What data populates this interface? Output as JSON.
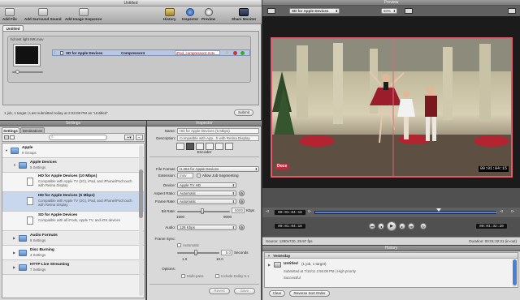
{
  "batch_window": {
    "title": "Untitled",
    "toolbar": {
      "add_file": "Add File",
      "add_surround": "Add Surround Sound",
      "add_image_sequence": "Add Image Sequence",
      "history": "History",
      "inspector": "Inspector",
      "preview": "Preview",
      "share_monitor": "Share Monitor"
    },
    "tab": "Untitled",
    "job": {
      "source_file": "hd test light NR.mov",
      "setting": "SD for Apple Devices",
      "destination": "Compressor4",
      "output_file": "iPod_compressor4.m4v"
    },
    "status": "1 job, 1 target  |  Last submitted today at 2:03:08 PM as \"Untitled\"",
    "submit": "Submit"
  },
  "settings_window": {
    "title": "Settings",
    "tabs": [
      "Settings",
      "Destinations"
    ],
    "items": [
      {
        "name": "Apple",
        "sub": "9 Groups",
        "kind": "group"
      },
      {
        "name": "Apple Devices",
        "sub": "5 Settings",
        "kind": "group"
      },
      {
        "name": "HD for Apple Devices (10 Mbps)",
        "sub": "Compatible with Apple TV (2G), iPad, and iPhone/iPod touch with Retina Display",
        "kind": "setting"
      },
      {
        "name": "HD for Apple Devices (5 Mbps)",
        "sub": "Compatible with Apple TV (2G), iPad, and iPhone/iPod touch with Retina Display",
        "kind": "setting"
      },
      {
        "name": "SD for Apple Devices",
        "sub": "Compatible with all iPods, Apple TV, and iOS devices",
        "kind": "setting"
      },
      {
        "name": "Audio Formats",
        "sub": "8 Settings",
        "kind": "group"
      },
      {
        "name": "Disc Burning",
        "sub": "3 Settings",
        "kind": "group"
      },
      {
        "name": "HTTP Live Streaming",
        "sub": "7 Settings",
        "kind": "group"
      }
    ]
  },
  "inspector_window": {
    "title": "Inspector",
    "name_label": "Name:",
    "name_value": "HD for Apple Devices (5 Mbps)",
    "description_label": "Description:",
    "description_value": "Compatible with App...h with Retina Display",
    "encoder_label": "Encoder",
    "file_format_label": "File Format:",
    "file_format_value": "H.264 for Apple Devices",
    "extension_label": "Extension:",
    "extension_value": "m4v",
    "job_segmenting": "Allow Job Segmenting",
    "device_label": "Device:",
    "device_value": "Apple TV HD",
    "aspect_label": "Aspect Ratio:",
    "aspect_value": "Automatic",
    "frame_rate_label": "Frame Rate:",
    "frame_rate_value": "Automatic",
    "bit_rate_label": "Bit Rate:",
    "bit_rate_value": "5000",
    "bit_rate_unit": "Kbps",
    "bit_rate_min": "1500",
    "bit_rate_max": "9000",
    "bit_rate_fraction": 0.47,
    "audio_label": "Audio:",
    "audio_value": "128 Kbps",
    "frame_sync_label": "Frame Sync:",
    "automatic_label": "Automatic",
    "seconds_value": "5.0",
    "seconds_unit": "Seconds",
    "sync_min": "1.0",
    "sync_max": "10.0",
    "sync_fraction": 0.45,
    "options_label": "Options:",
    "multipass": "Multi-pass",
    "include_dolby": "Include Dolby 5.1",
    "revert": "Revert",
    "save": "Save"
  },
  "preview_window": {
    "title": "Preview",
    "setting_select": "SD for Apple Devices",
    "zoom": "50%",
    "watermark": "Doce",
    "video_timecode": "00:01:04:15",
    "in_timecode": "00:01:04:18",
    "out_timecode": "00:01:32:20",
    "source_info": "Source: 1280x720, 29.97 fps",
    "duration_info": "Duration: 00:01:32:21 (in-out)"
  },
  "history_window": {
    "title": "History",
    "section": "Yesterday",
    "entry_title": "Untitled",
    "entry_count": "(1 job, 1 target)",
    "entry_detail": "Submitted at 7/10/11 2:55:08 PM  |  High priority",
    "entry_status": "Successful",
    "clear": "Clear",
    "reverse_sort": "Reverse Sort Order"
  },
  "colors": {
    "accent": "#3b6fc4",
    "selection": "#c9d7ee",
    "video_frame": "#e05a6c"
  }
}
